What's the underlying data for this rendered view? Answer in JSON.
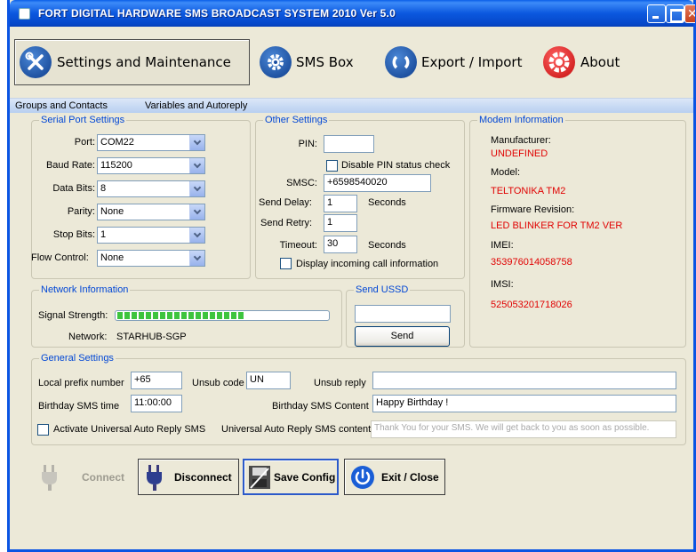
{
  "window": {
    "title": "FORT DIGITAL HARDWARE SMS BROADCAST SYSTEM 2010 Ver 5.0"
  },
  "toolbar": {
    "settings": {
      "label": "Settings and Maintenance",
      "icon": "wrench-screwdriver-icon"
    },
    "smsbox": {
      "label": "SMS Box",
      "icon": "gear-icon"
    },
    "export": {
      "label": "Export / Import",
      "icon": "sync-arrows-icon"
    },
    "about": {
      "label": "About",
      "icon": "help-lifebuoy-icon"
    }
  },
  "subnav": {
    "groups": "Groups and Contacts",
    "variables": "Variables and Autoreply"
  },
  "serial": {
    "legend": "Serial Port Settings",
    "port_label": "Port:",
    "port_value": "COM22",
    "baud_label": "Baud Rate:",
    "baud_value": "115200",
    "databits_label": "Data Bits:",
    "databits_value": "8",
    "parity_label": "Parity:",
    "parity_value": "None",
    "stopbits_label": "Stop Bits:",
    "stopbits_value": "1",
    "flow_label": "Flow Control:",
    "flow_value": "None"
  },
  "other": {
    "legend": "Other Settings",
    "pin_label": "PIN:",
    "pin_value": "",
    "disable_pin_label": "Disable PIN status check",
    "smsc_label": "SMSC:",
    "smsc_value": "+6598540020",
    "delay_label": "Send Delay:",
    "delay_value": "1",
    "delay_unit": "Seconds",
    "retry_label": "Send Retry:",
    "retry_value": "1",
    "timeout_label": "Timeout:",
    "timeout_value": "30",
    "timeout_unit": "Seconds",
    "display_call_label": "Display incoming call information"
  },
  "modem": {
    "legend": "Modem Information",
    "manufacturer_label": "Manufacturer:",
    "manufacturer_value": "UNDEFINED",
    "model_label": "Model:",
    "model_value": "TELTONIKA TM2",
    "firmware_label": "Firmware Revision:",
    "firmware_value": "LED BLINKER FOR TM2 VER",
    "imei_label": "IMEI:",
    "imei_value": "353976014058758",
    "imsi_label": "IMSI:",
    "imsi_value": "525053201718026"
  },
  "network": {
    "legend": "Network Information",
    "signal_label": "Signal Strength:",
    "signal_level": 0.6,
    "network_label": "Network:",
    "network_value": "STARHUB-SGP"
  },
  "ussd": {
    "legend": "Send USSD",
    "input_value": "",
    "send_label": "Send"
  },
  "general": {
    "legend": "General Settings",
    "local_prefix_label": "Local prefix number",
    "local_prefix_value": "+65",
    "unsub_code_label": "Unsub code",
    "unsub_code_value": "UN",
    "unsub_reply_label": "Unsub reply",
    "unsub_reply_value": "",
    "birthday_time_label": "Birthday SMS time",
    "birthday_time_value": "11:00:00",
    "birthday_content_label": "Birthday SMS Content",
    "birthday_content_value": "Happy Birthday !",
    "auto_reply_label": "Activate Universal Auto Reply SMS",
    "auto_reply_content_label": "Universal Auto Reply SMS content",
    "auto_reply_content_value": "Thank You for your SMS. We will get back to you as soon as possible."
  },
  "actions": {
    "connect_label": "Connect",
    "disconnect_label": "Disconnect",
    "save_label": "Save Config",
    "exit_label": "Exit / Close"
  }
}
